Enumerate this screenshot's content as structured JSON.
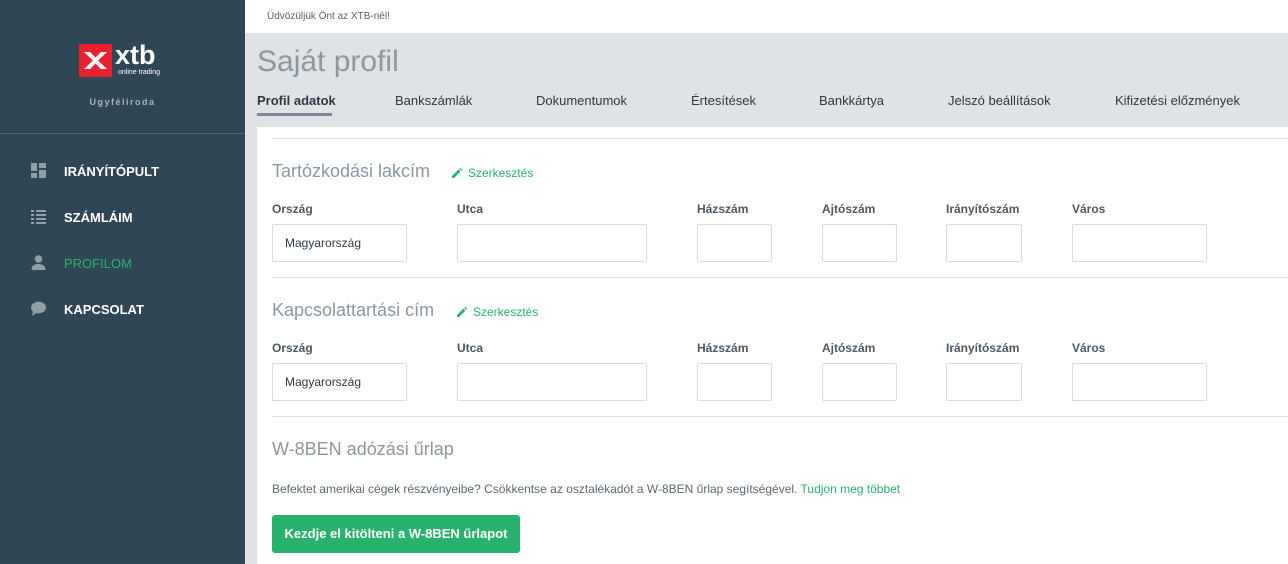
{
  "sidebar": {
    "logo_text": "xtb",
    "logo_subtitle": "online trading",
    "office_label": "Ugyféliroda",
    "items": [
      {
        "label": "IRÁNYÍTÓPULT",
        "icon": "dashboard-icon"
      },
      {
        "label": "SZÁMLÁIM",
        "icon": "list-icon"
      },
      {
        "label": "PROFILOM",
        "icon": "user-icon",
        "active": true
      },
      {
        "label": "KAPCSOLAT",
        "icon": "chat-icon"
      }
    ]
  },
  "header": {
    "welcome": "Üdvözüljük Önt az XTB-nél!",
    "title": "Saját profil",
    "tabs": [
      {
        "label": "Profil adatok",
        "active": true
      },
      {
        "label": "Bankszámlák"
      },
      {
        "label": "Dokumentumok"
      },
      {
        "label": "Értesítések"
      },
      {
        "label": "Bankkártya"
      },
      {
        "label": "Jelszó beállítások"
      },
      {
        "label": "Kifizetési előzmények"
      }
    ]
  },
  "residence": {
    "title": "Tartózkodási lakcím",
    "edit_label": "Szerkesztés",
    "labels": [
      "Ország",
      "Utca",
      "Házszám",
      "Ajtószám",
      "Irányítószám",
      "Város"
    ],
    "values": [
      "Magyarország",
      "",
      "",
      "",
      "",
      ""
    ]
  },
  "contact": {
    "title": "Kapcsolattartási cím",
    "edit_label": "Szerkesztés",
    "labels": [
      "Ország",
      "Utca",
      "Házszám",
      "Ajtószám",
      "Irányítószám",
      "Város"
    ],
    "values": [
      "Magyarország",
      "",
      "",
      "",
      "",
      ""
    ]
  },
  "w8ben": {
    "title": "W-8BEN adózási űrlap",
    "description": "Befektet amerikai cégek részvényeibe? Csökkentse az osztalékadót a W-8BEN űrlap segítségével.",
    "link": "Tudjon meg többet",
    "button": "Kezdje el kitölteni a W-8BEN űrlapot"
  },
  "colors": {
    "sidebar_bg": "#2f4656",
    "accent_green": "#29b26d",
    "brand_red": "#e8202f"
  }
}
